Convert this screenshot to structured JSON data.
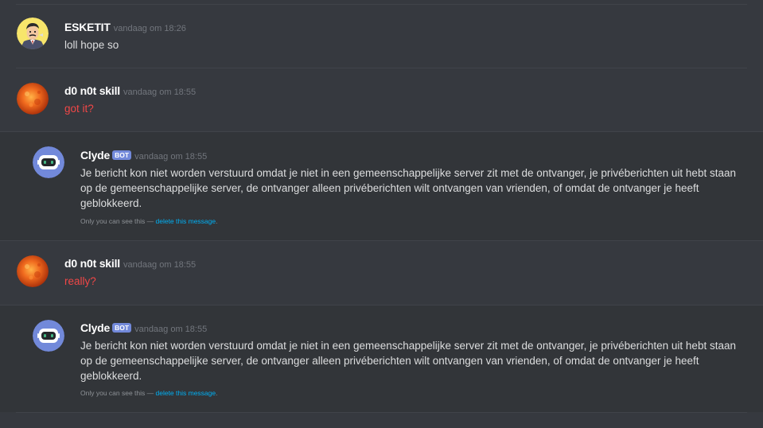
{
  "messages": [
    {
      "username": "ESKETIT",
      "timestamp": "vandaag om 18:26",
      "text": "loll hope so",
      "avatar_icon": "cartoon-man-avatar"
    },
    {
      "username": "d0 n0t skill",
      "timestamp": "vandaag om 18:55",
      "text": "got it?",
      "text_color": "#f04747",
      "avatar_icon": "sun-avatar"
    },
    {
      "username": "Clyde",
      "bot_tag": "BOT",
      "timestamp": "vandaag om 18:55",
      "text": "Je bericht kon niet worden verstuurd omdat je niet in een gemeenschappelijke server zit met de ontvanger, je privéberichten uit hebt staan op de gemeenschappelijke server, de ontvanger alleen privéberichten wilt ontvangen van vrienden, of omdat de ontvanger je heeft geblokkeerd.",
      "note_prefix": "Only you can see this — ",
      "note_link": "delete this message",
      "note_suffix": ".",
      "avatar_icon": "clyde-robot-avatar"
    },
    {
      "username": "d0 n0t skill",
      "timestamp": "vandaag om 18:55",
      "text": "really?",
      "text_color": "#f04747",
      "avatar_icon": "sun-avatar"
    },
    {
      "username": "Clyde",
      "bot_tag": "BOT",
      "timestamp": "vandaag om 18:55",
      "text": "Je bericht kon niet worden verstuurd omdat je niet in een gemeenschappelijke server zit met de ontvanger, je privéberichten uit hebt staan op de gemeenschappelijke server, de ontvanger alleen privéberichten wilt ontvangen van vrienden, of omdat de ontvanger je heeft geblokkeerd.",
      "note_prefix": "Only you can see this — ",
      "note_link": "delete this message",
      "note_suffix": ".",
      "avatar_icon": "clyde-robot-avatar"
    }
  ],
  "colors": {
    "background": "#36393f",
    "username": "#ffffff",
    "timestamp": "#72767d",
    "message_text": "#dcddde",
    "red_text": "#f04747",
    "bot_tag": "#7289da",
    "link": "#00b0f4"
  }
}
